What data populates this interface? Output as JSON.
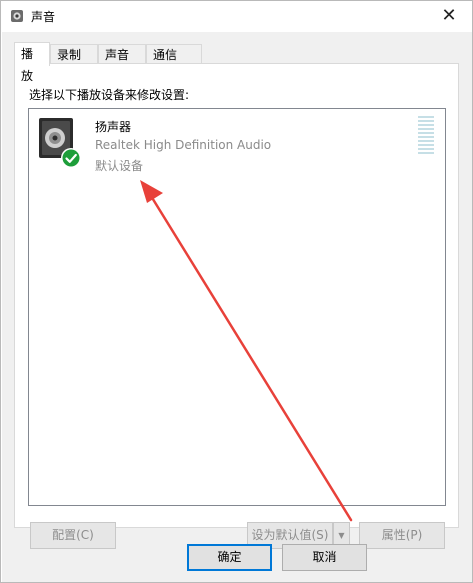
{
  "window": {
    "title": "声音",
    "icon": "speaker-icon",
    "close_glyph": "✕"
  },
  "tabs": [
    {
      "label": "播放",
      "active": true
    },
    {
      "label": "录制",
      "active": false
    },
    {
      "label": "声音",
      "active": false
    },
    {
      "label": "通信",
      "active": false
    }
  ],
  "playback": {
    "instruction": "选择以下播放设备来修改设置:",
    "devices": [
      {
        "name": "扬声器",
        "driver": "Realtek High Definition Audio",
        "status": "默认设备",
        "icon": "speaker-device-icon",
        "badge": "green-checkmark-icon"
      }
    ],
    "buttons": {
      "configure": "配置(C)",
      "set_default": "设为默认值(S)",
      "dropdown_glyph": "▼",
      "properties": "属性(P)"
    }
  },
  "dialog_buttons": {
    "ok": "确定",
    "cancel": "取消"
  },
  "colors": {
    "annotation_arrow": "#e8413a",
    "selection_check": "#1e9e3a",
    "default_button_border": "#0078d7"
  }
}
